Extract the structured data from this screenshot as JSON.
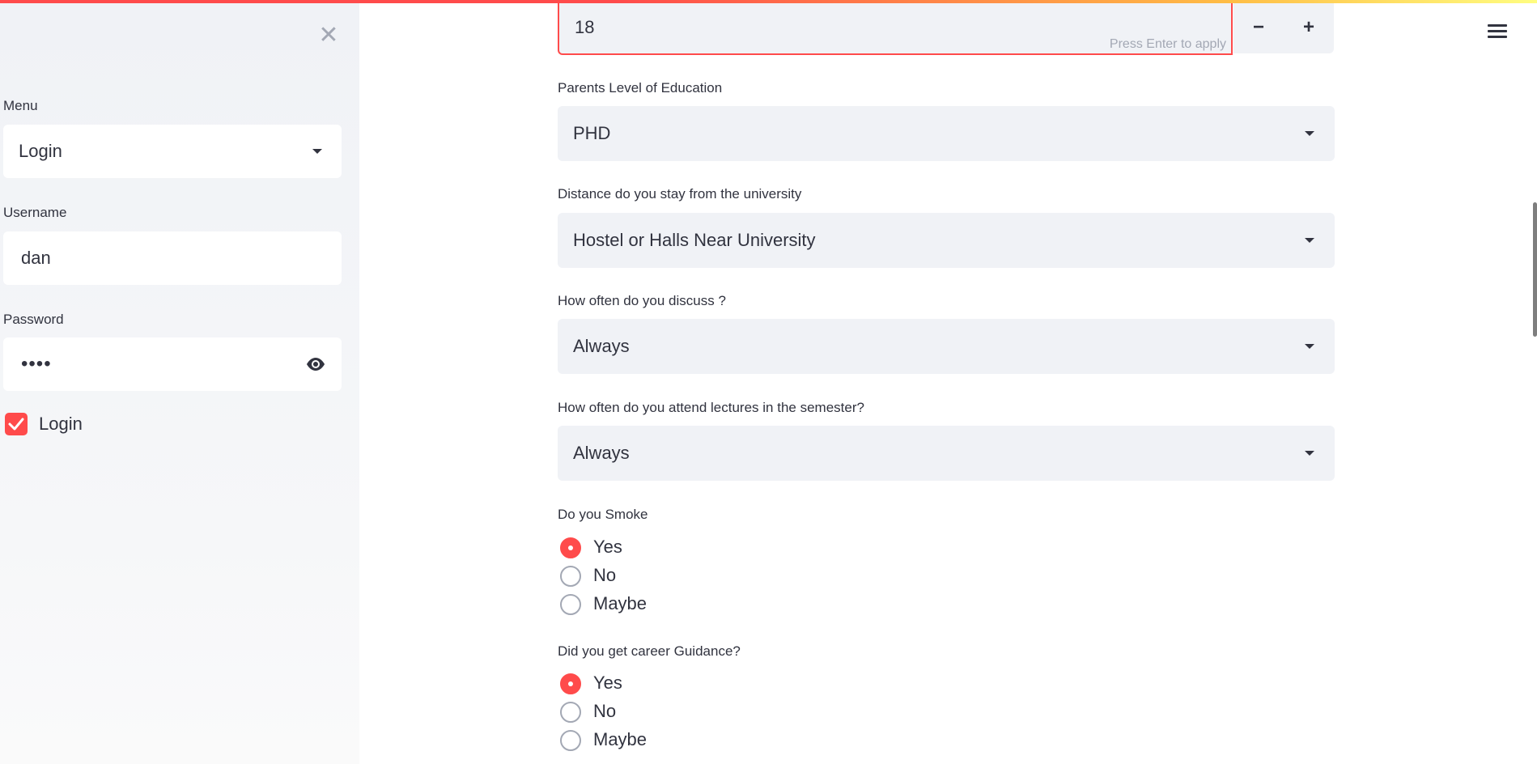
{
  "sidebar": {
    "close_icon": "close-icon",
    "menu_label": "Menu",
    "menu_value": "Login",
    "username_label": "Username",
    "username_value": "dan",
    "password_label": "Password",
    "password_value": "••••",
    "show_password_icon": "eye-icon",
    "login_checkbox_label": "Login",
    "login_checked": true
  },
  "main": {
    "age_value": "18",
    "age_hint": "Press Enter to apply",
    "stepper_minus": "−",
    "stepper_plus": "+",
    "menu_icon": "hamburger-icon",
    "parents_education": {
      "label": "Parents Level of Education",
      "value": "PHD"
    },
    "distance": {
      "label": "Distance do you stay from the university",
      "value": "Hostel or Halls Near University"
    },
    "discuss": {
      "label": "How often do you discuss ?",
      "value": "Always"
    },
    "attend": {
      "label": "How often do you attend lectures in the semester?",
      "value": "Always"
    },
    "smoke": {
      "label": "Do you Smoke",
      "options": [
        "Yes",
        "No",
        "Maybe"
      ],
      "selected": "Yes"
    },
    "career": {
      "label": "Did you get career Guidance?",
      "options": [
        "Yes",
        "No",
        "Maybe"
      ],
      "selected": "Yes"
    }
  },
  "colors": {
    "accent": "#ff4b4b",
    "sidebar_bg": "#f0f2f6",
    "input_bg": "#f0f2f6",
    "text": "#31333f",
    "muted": "#a3a8b4"
  }
}
